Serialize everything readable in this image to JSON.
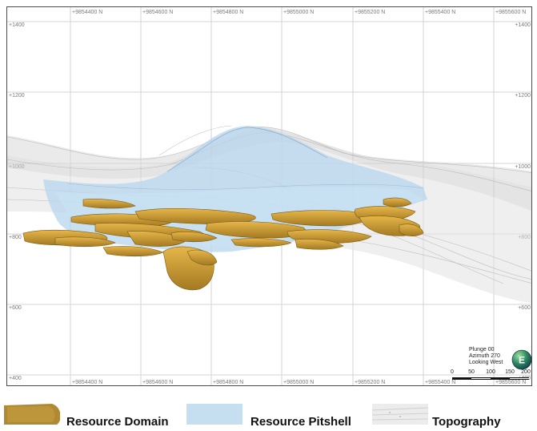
{
  "grid": {
    "northing_labels": [
      "+9854400 N",
      "+9854600 N",
      "+9854800 N",
      "+9855000 N",
      "+9855200 N",
      "+9855400 N",
      "+9855600 N"
    ],
    "elevation_labels": [
      "+1400",
      "+1200",
      "+1000",
      "+800",
      "+600",
      "+400"
    ]
  },
  "orientation": {
    "plunge": "Plunge 00",
    "azimuth": "Azimuth 270",
    "looking": "Looking West",
    "compass_letter": "E"
  },
  "scale_bar": {
    "ticks": [
      "0",
      "50",
      "100",
      "150",
      "200"
    ]
  },
  "legend": {
    "items": [
      {
        "label": "Resource Domain",
        "color": "#b08a32"
      },
      {
        "label": "Resource Pitshell",
        "color": "#c5def0"
      },
      {
        "label": "Topography",
        "color": "#e2e2e2"
      }
    ]
  },
  "colors": {
    "domain": "#d4a237",
    "domain_dark": "#8c6a1e",
    "pitshell": "#b7d6ee",
    "topography": "#bfbfbf",
    "grid": "#c8c8c8"
  }
}
